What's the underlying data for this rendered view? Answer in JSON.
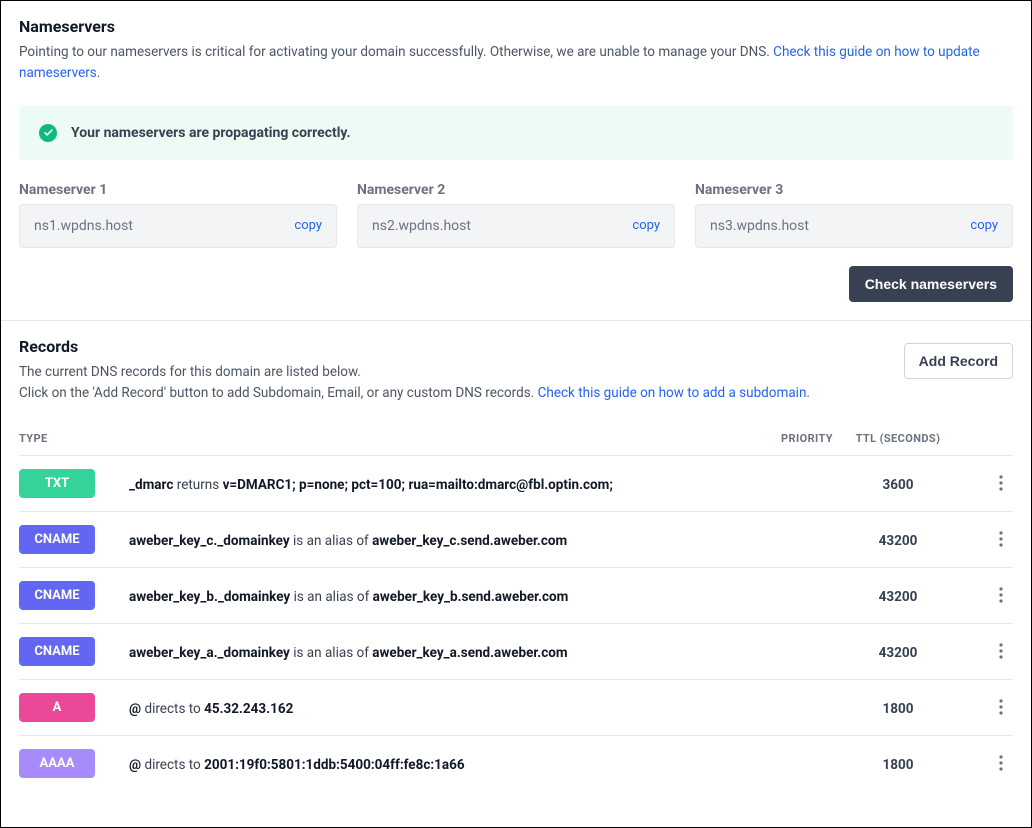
{
  "nameservers": {
    "title": "Nameservers",
    "desc_prefix": "Pointing to our nameservers is critical for activating your domain successfully. Otherwise, we are unable to manage your DNS. ",
    "desc_link": "Check this guide on how to update nameservers",
    "desc_suffix": ".",
    "alert": "Your nameservers are propagating correctly.",
    "items": [
      {
        "label": "Nameserver 1",
        "value": "ns1.wpdns.host",
        "copy": "copy"
      },
      {
        "label": "Nameserver 2",
        "value": "ns2.wpdns.host",
        "copy": "copy"
      },
      {
        "label": "Nameserver 3",
        "value": "ns3.wpdns.host",
        "copy": "copy"
      }
    ],
    "check_btn": "Check nameservers"
  },
  "records": {
    "title": "Records",
    "desc1": "The current DNS records for this domain are listed below.",
    "desc2_prefix": "Click on the 'Add Record' button to add Subdomain, Email, or any custom DNS records. ",
    "desc2_link": "Check this guide on how to add a subdomain",
    "desc2_suffix": ".",
    "add_btn": "Add Record",
    "head": {
      "type": "TYPE",
      "priority": "PRIORITY",
      "ttl": "TTL (SECONDS)"
    },
    "rows": [
      {
        "type": "TXT",
        "badge_class": "badge-txt",
        "name": "_dmarc",
        "verb": " returns ",
        "target": "v=DMARC1; p=none; pct=100; rua=mailto:dmarc@fbl.optin.com;",
        "ttl": "3600"
      },
      {
        "type": "CNAME",
        "badge_class": "badge-cname",
        "name": "aweber_key_c._domainkey",
        "verb": " is an alias of ",
        "target": "aweber_key_c.send.aweber.com",
        "ttl": "43200"
      },
      {
        "type": "CNAME",
        "badge_class": "badge-cname",
        "name": "aweber_key_b._domainkey",
        "verb": " is an alias of ",
        "target": "aweber_key_b.send.aweber.com",
        "ttl": "43200"
      },
      {
        "type": "CNAME",
        "badge_class": "badge-cname",
        "name": "aweber_key_a._domainkey",
        "verb": " is an alias of ",
        "target": "aweber_key_a.send.aweber.com",
        "ttl": "43200"
      },
      {
        "type": "A",
        "badge_class": "badge-a",
        "name": "@",
        "verb": " directs to ",
        "target": "45.32.243.162",
        "ttl": "1800"
      },
      {
        "type": "AAAA",
        "badge_class": "badge-aaaa",
        "name": "@",
        "verb": " directs to ",
        "target": "2001:19f0:5801:1ddb:5400:04ff:fe8c:1a66",
        "ttl": "1800"
      }
    ]
  }
}
